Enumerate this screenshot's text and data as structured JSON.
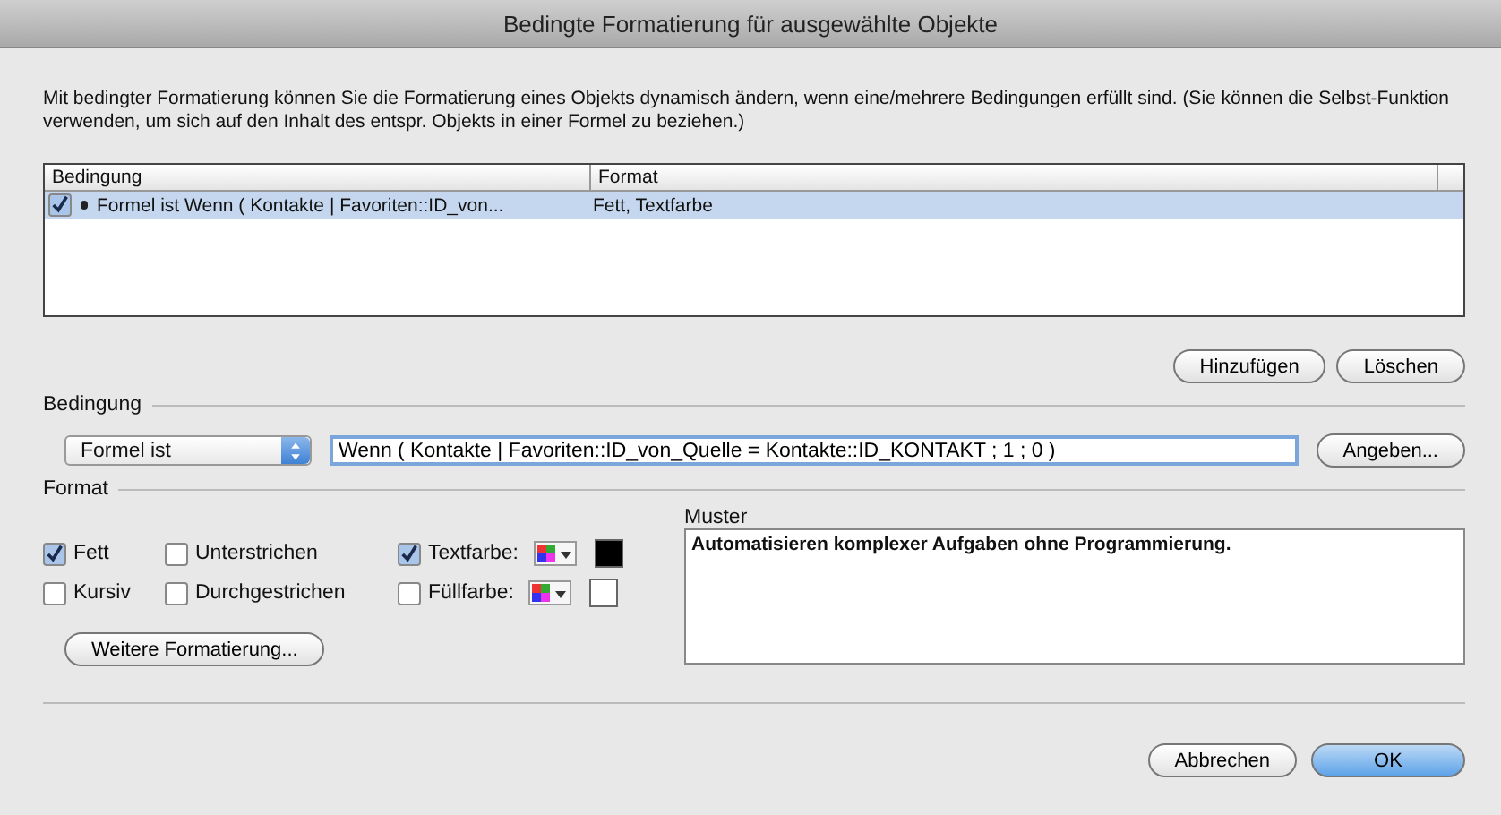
{
  "window": {
    "title": "Bedingte Formatierung für ausgewählte Objekte"
  },
  "description": "Mit bedingter Formatierung können Sie die Formatierung eines Objekts dynamisch ändern, wenn eine/mehrere Bedingungen erfüllt sind.  (Sie können die Selbst-Funktion verwenden, um sich auf den Inhalt des entspr. Objekts in einer Formel zu beziehen.)",
  "table": {
    "columns": [
      "Bedingung",
      "Format"
    ],
    "rows": [
      {
        "checked": true,
        "selected": true,
        "condition": "Formel ist Wenn ( Kontakte | Favoriten::ID_von...",
        "format": "Fett, Textfarbe"
      }
    ]
  },
  "table_buttons": [
    "Hinzufügen",
    "Löschen"
  ],
  "condition": {
    "label": "Bedingung",
    "type": "Formel ist",
    "formula": "Wenn ( Kontakte | Favoriten::ID_von_Quelle = Kontakte::ID_KONTAKT ; 1 ; 0 )",
    "specify_button": "Angeben..."
  },
  "format": {
    "label": "Format",
    "options": [
      {
        "kind": "style",
        "label": "Fett",
        "checked": true
      },
      {
        "kind": "style",
        "label": "Unterstrichen",
        "checked": false
      },
      {
        "kind": "color",
        "label": "Textfarbe:",
        "checked": true,
        "color": "#000000"
      },
      {
        "kind": "style",
        "label": "Kursiv",
        "checked": false
      },
      {
        "kind": "style",
        "label": "Durchgestrichen",
        "checked": false
      },
      {
        "kind": "color",
        "label": "Füllfarbe:",
        "checked": false,
        "color": "#ffffff"
      }
    ],
    "more_button": "Weitere Formatierung..."
  },
  "preview": {
    "label": "Muster",
    "text": "Automatisieren komplexer Aufgaben ohne Programmierung."
  },
  "buttons": [
    {
      "label": "Abbrechen",
      "default": false
    },
    {
      "label": "OK",
      "default": true
    }
  ]
}
